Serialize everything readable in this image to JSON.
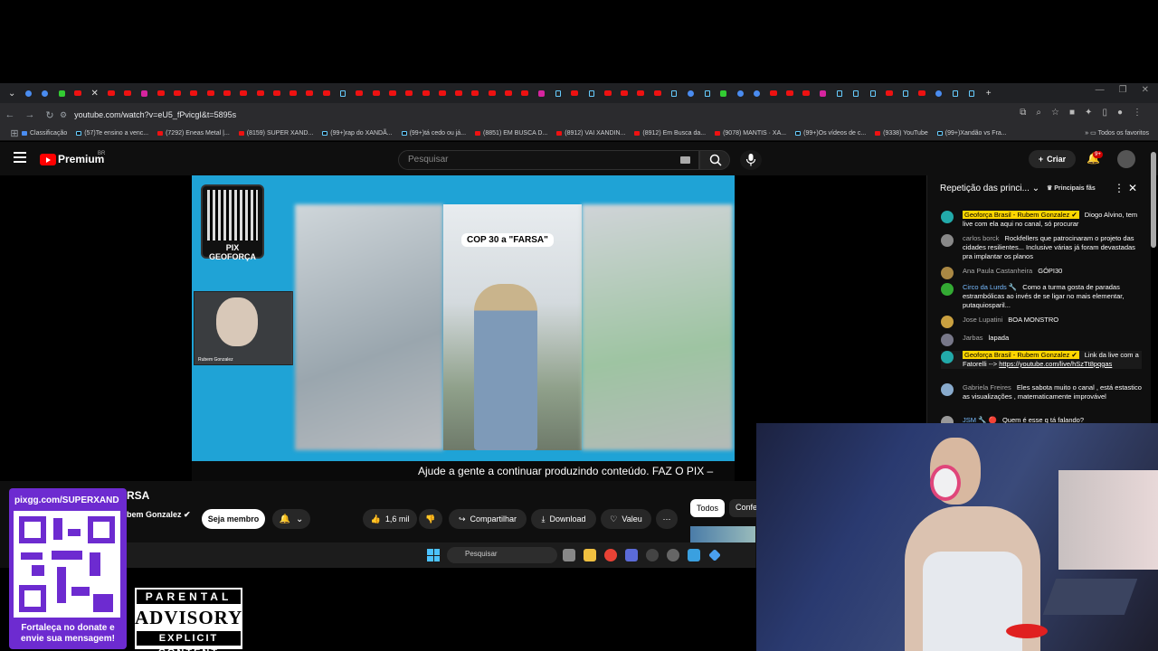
{
  "browser": {
    "url": "youtube.com/watch?v=eU5_fPvicgI&t=5895s",
    "bookmarks": [
      "Classificação",
      "(57)Te ensino a venc...",
      "(7292) Eneas Metal |...",
      "(8159) SUPER XAND...",
      "(99+)rap do XANDÃ...",
      "(99+)tá cedo ou já...",
      "(8851) EM BUSCA D...",
      "(8912) VAI XANDIN...",
      "(8912) Em Busca da...",
      "(9078) MANTIS · XA...",
      "(99+)Os vídeos de c...",
      "(9338) YouTube",
      "(99+)Xandão vs Fra..."
    ],
    "favorites_label": "Todos os favoritos"
  },
  "youtube": {
    "brand": "Premium",
    "region": "BR",
    "search_placeholder": "Pesquisar",
    "create_label": "Criar",
    "notifications_badge": "9+"
  },
  "video": {
    "qr_label": "PIX GEOFORÇA",
    "cam_name": "Rubem Gonzalez",
    "overlay_title": "COP 30 a \"FARSA\"",
    "ticker": "Ajude a gente a continuar produzindo conteúdo. FAZ O PIX –",
    "title_fragment": "RSA",
    "channel_fragment": "bem Gonzalez ✔",
    "member_label": "Seja membro",
    "likes": "1,6 mil",
    "share_label": "Compartilhar",
    "download_label": "Download",
    "thanks_label": "Valeu"
  },
  "filters": {
    "all": "Todos",
    "conf": "Confe"
  },
  "taskbar": {
    "search": "Pesquisar"
  },
  "chat": {
    "title": "Repetição das princi...",
    "mode": "Principais fãs",
    "messages": [
      {
        "author": "Geoforça Brasil - Rubem Gonzalez ✔",
        "text": "Diogo Alvino, tem live com ela aqui no canal, só procurar",
        "owner": true
      },
      {
        "author": "carlos borck",
        "text": "Rockfellers que patrocinaram o projeto das cidades resilientes... Inclusive várias já foram devastadas pra implantar os planos",
        "owner": false
      },
      {
        "author": "Ana Paula Castanheira",
        "text": "GÓPI30",
        "owner": false
      },
      {
        "author": "Circo da Lurds 🔧",
        "text": "Como a turma gosta de paradas estrambólicas ao invés de se ligar no mais elementar, putaquiosparil...",
        "owner": false
      },
      {
        "author": "Jose Lupatini",
        "text": "BOA MONSTRO",
        "owner": false
      },
      {
        "author": "Jarbas",
        "text": "lapada",
        "owner": false
      },
      {
        "author": "Geoforça Brasil - Rubem Gonzalez ✔",
        "text": "Link da live com a Fatorelli -->",
        "link": "https://youtube.com/live/hSzTt8pqgas",
        "owner": true
      },
      {
        "author": "Gabriela Freires",
        "text": "Eles sabota muito o canal , está estastico as visualizações , matematicamente improvável",
        "owner": false
      },
      {
        "author": "JSM 🔧 🔴",
        "text": "Quem é esse q tá falando?",
        "owner": false
      }
    ]
  },
  "overlay": {
    "pix_url": "pixgg.com/SUPERXAND",
    "pix_caption": "Fortaleça no donate e envie sua mensagem!",
    "advisory_top": "PARENTAL",
    "advisory_mid": "ADVISORY",
    "advisory_bot": "EXPLICIT CONTENT"
  }
}
